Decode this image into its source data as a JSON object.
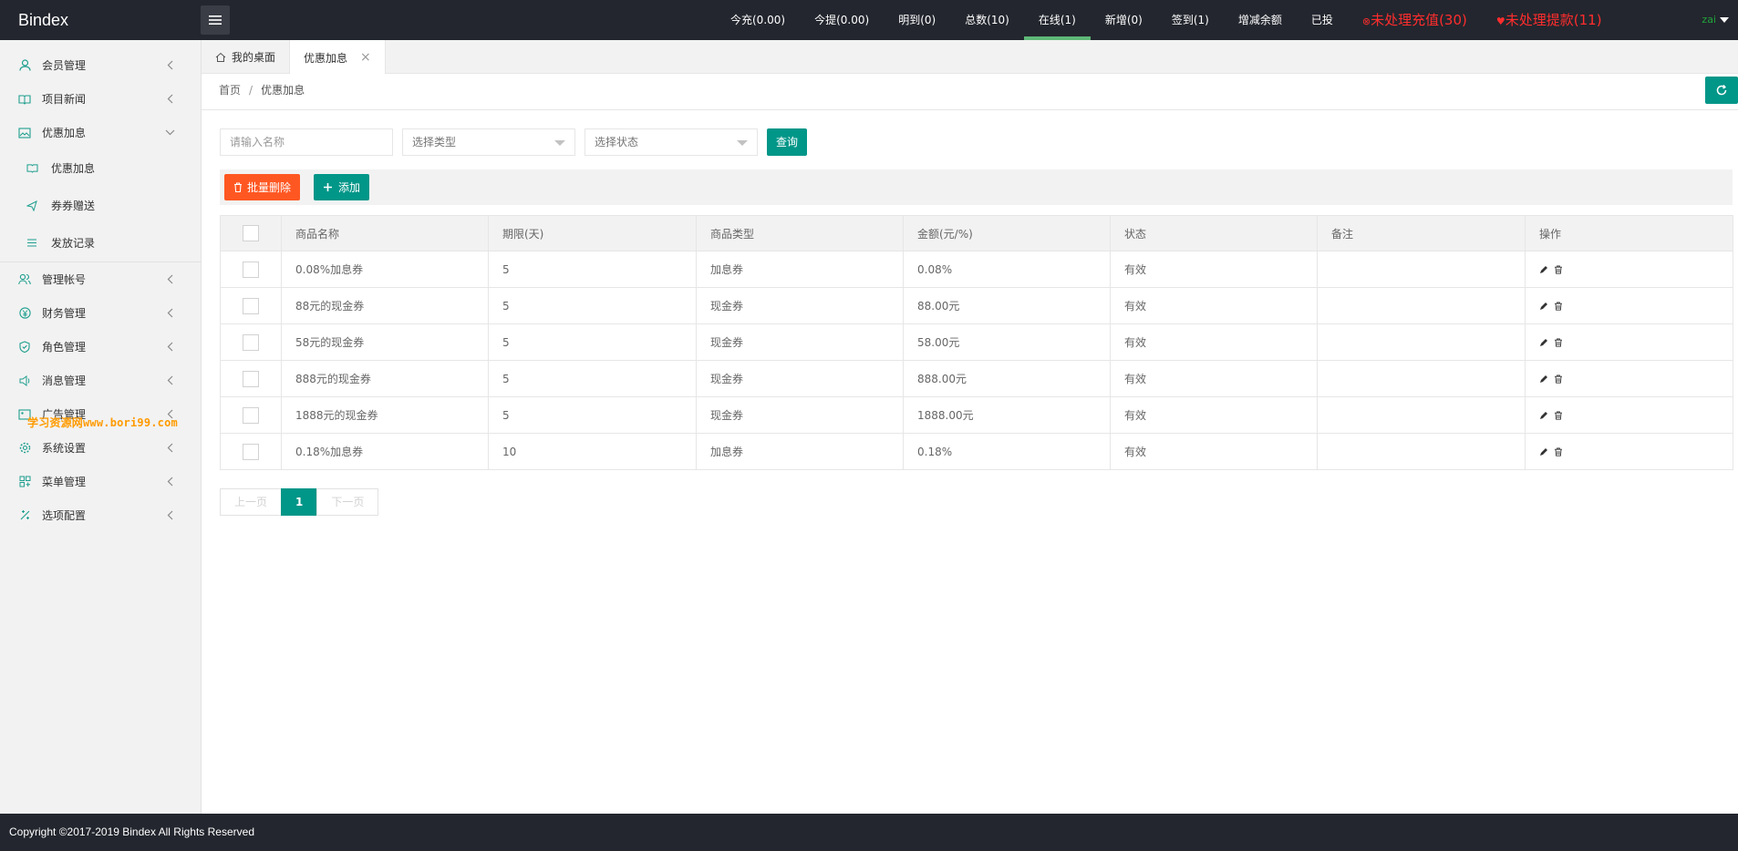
{
  "app": {
    "title": "Bindex"
  },
  "header": {
    "nav": [
      {
        "label": "今充(0.00)"
      },
      {
        "label": "今提(0.00)"
      },
      {
        "label": "明到(0)"
      },
      {
        "label": "总数(10)"
      },
      {
        "label": "在线(1)",
        "active": true
      },
      {
        "label": "新增(0)"
      },
      {
        "label": "签到(1)"
      },
      {
        "label": "增减余额"
      },
      {
        "label": "已投"
      }
    ],
    "alerts": [
      {
        "label": "未处理充值(30)"
      },
      {
        "label": "未处理提款(11)"
      }
    ],
    "user": "zai",
    "colors": {
      "bar": "#23262e",
      "active_underline": "#5fb878",
      "alert": "#ff2d2d"
    }
  },
  "sidebar": {
    "items": [
      {
        "label": "会员管理",
        "icon": "user-icon"
      },
      {
        "label": "项目新闻",
        "icon": "book-icon"
      },
      {
        "label": "优惠加息",
        "icon": "image-icon",
        "expanded": true
      }
    ],
    "sub_items": [
      {
        "label": "优惠加息",
        "icon": "book-icon"
      },
      {
        "label": "券券赠送",
        "icon": "send-icon"
      },
      {
        "label": "发放记录",
        "icon": "list-icon"
      }
    ],
    "items_after": [
      {
        "label": "管理帐号",
        "icon": "users-icon"
      },
      {
        "label": "财务管理",
        "icon": "yen-icon"
      },
      {
        "label": "角色管理",
        "icon": "shield-icon"
      },
      {
        "label": "消息管理",
        "icon": "speaker-icon"
      },
      {
        "label": "广告管理",
        "icon": "picture-icon"
      },
      {
        "label": "系统设置",
        "icon": "gear-icon"
      },
      {
        "label": "菜单管理",
        "icon": "app-icon"
      },
      {
        "label": "选项配置",
        "icon": "config-icon"
      }
    ],
    "watermark": "学习资源网www.bori99.com"
  },
  "tabs": [
    {
      "label": "我的桌面",
      "icon": "home-icon"
    },
    {
      "label": "优惠加息",
      "active": true,
      "closable": true
    }
  ],
  "breadcrumb": {
    "home": "首页",
    "separator": "/",
    "current": "优惠加息"
  },
  "search": {
    "name_placeholder": "请输入名称",
    "type_select": "选择类型",
    "status_select": "选择状态",
    "query_label": "查询"
  },
  "toolbar": {
    "batch_delete_label": "批量删除",
    "add_label": "添加"
  },
  "table": {
    "columns": [
      "商品名称",
      "期限(天)",
      "商品类型",
      "金额(元/%)",
      "状态",
      "备注",
      "操作"
    ],
    "rows": [
      {
        "name": "0.08%加息券",
        "days": "5",
        "type": "加息券",
        "amount": "0.08%",
        "status": "有效",
        "note": ""
      },
      {
        "name": "88元的现金券",
        "days": "5",
        "type": "现金券",
        "amount": "88.00元",
        "status": "有效",
        "note": ""
      },
      {
        "name": "58元的现金券",
        "days": "5",
        "type": "现金券",
        "amount": "58.00元",
        "status": "有效",
        "note": ""
      },
      {
        "name": "888元的现金券",
        "days": "5",
        "type": "现金券",
        "amount": "888.00元",
        "status": "有效",
        "note": ""
      },
      {
        "name": "1888元的现金券",
        "days": "5",
        "type": "现金券",
        "amount": "1888.00元",
        "status": "有效",
        "note": ""
      },
      {
        "name": "0.18%加息券",
        "days": "10",
        "type": "加息券",
        "amount": "0.18%",
        "status": "有效",
        "note": ""
      }
    ]
  },
  "pager": {
    "prev": "上一页",
    "current": "1",
    "next": "下一页"
  },
  "footer": {
    "copyright": "Copyright ©2017-2019 Bindex All Rights Reserved"
  },
  "colors": {
    "primary": "#009688",
    "danger": "#ff5722"
  }
}
